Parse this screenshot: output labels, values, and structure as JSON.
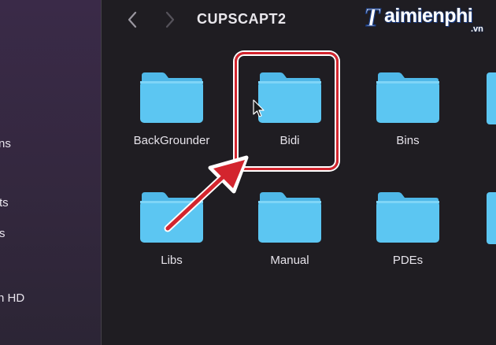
{
  "window": {
    "title": "CUPSCAPT2"
  },
  "toolbar": {
    "back_label": "‹",
    "forward_label": "›"
  },
  "sidebar": {
    "items": [
      {
        "label": "ns"
      },
      {
        "label": "ts"
      },
      {
        "label": "s"
      },
      {
        "label": "n HD"
      }
    ]
  },
  "folders": [
    {
      "name": "BackGrounder"
    },
    {
      "name": "Bidi"
    },
    {
      "name": "Bins"
    },
    {
      "name": "Libs"
    },
    {
      "name": "Manual"
    },
    {
      "name": "PDEs"
    }
  ],
  "watermark": {
    "brand": "aimienphi",
    "initial": "T",
    "suffix": ".vn"
  },
  "colors": {
    "folder_body": "#5cc6f2",
    "folder_tab": "#4fb8e8",
    "highlight_border": "#d3252e",
    "arrow": "#d3252e"
  }
}
